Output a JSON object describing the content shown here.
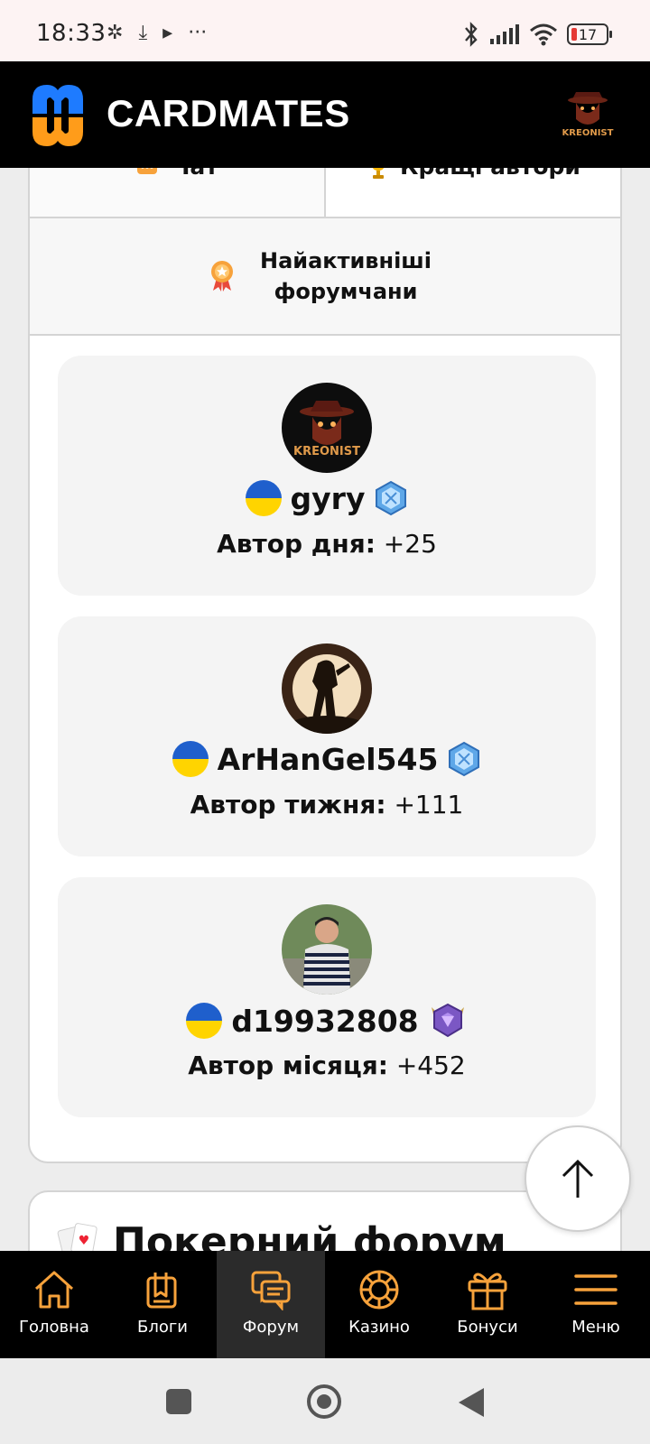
{
  "status_bar": {
    "time": "18:33",
    "battery": "17",
    "left_icons": [
      "nfc-icon",
      "download-icon",
      "play-icon",
      "more-icon"
    ],
    "right_icons": [
      "bluetooth-icon",
      "signal-icon",
      "wifi-icon",
      "battery-icon"
    ]
  },
  "header": {
    "logo_text": "CARDMATES",
    "brand_colors": [
      "#1e7bff",
      "#ff9c1a"
    ]
  },
  "tabs": [
    {
      "label": "Чат",
      "icon": "chat-icon"
    },
    {
      "label": "Кращі автори",
      "icon": "trophy-icon"
    }
  ],
  "wide_tab": {
    "label": "Найактивніші форумчани",
    "icon": "medal-icon"
  },
  "authors": [
    {
      "username": "gyry",
      "period_label": "Автор дня:",
      "score": "+25",
      "badge": "diamond-blue-badge"
    },
    {
      "username": "ArHanGel545",
      "period_label": "Автор тижня:",
      "score": "+111",
      "badge": "diamond-blue-badge"
    },
    {
      "username": "d19932808",
      "period_label": "Автор місяця:",
      "score": "+452",
      "badge": "amethyst-badge"
    }
  ],
  "section2": {
    "title": "Покерний форум",
    "icon": "cards-icon"
  },
  "bottom_nav": [
    {
      "label": "Головна",
      "icon": "home-icon",
      "active": false
    },
    {
      "label": "Блоги",
      "icon": "blog-icon",
      "active": false
    },
    {
      "label": "Форум",
      "icon": "forum-icon",
      "active": true
    },
    {
      "label": "Казино",
      "icon": "casino-chip-icon",
      "active": false
    },
    {
      "label": "Бонуси",
      "icon": "gift-icon",
      "active": false
    },
    {
      "label": "Меню",
      "icon": "hamburger-icon",
      "active": false
    }
  ],
  "accent_color": "#f7a23b"
}
